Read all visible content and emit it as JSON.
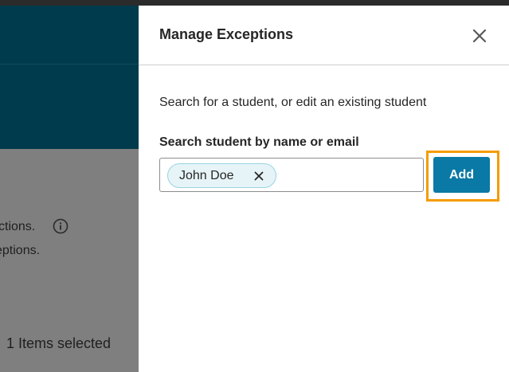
{
  "background": {
    "line1_text": "ctions.",
    "line2_text": "eptions.",
    "selected_text": "1 Items selected",
    "info_icon": "info-circle-icon"
  },
  "drawer": {
    "title": "Manage Exceptions",
    "close_icon": "close-icon",
    "description": "Search for a student, or edit an existing student",
    "search_label": "Search student by name or email",
    "chip": {
      "label": "John Doe",
      "remove_icon": "close-icon"
    },
    "add_label": "Add"
  },
  "colors": {
    "header": "#003a4d",
    "accent_button": "#0a79a6",
    "highlight": "#f59b00",
    "chip_background": "#e6f4f8",
    "chip_border": "#9ad3e0"
  }
}
